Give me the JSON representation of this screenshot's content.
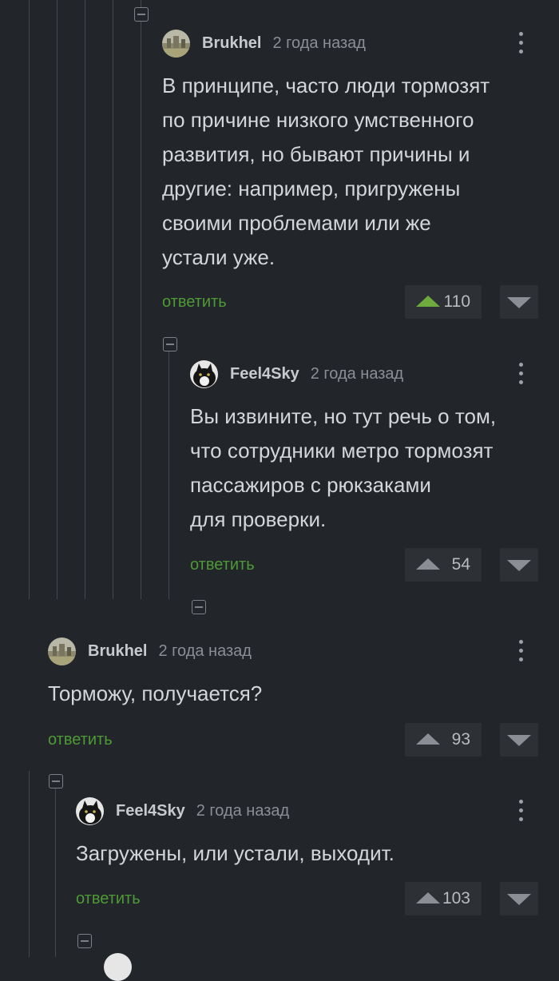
{
  "comments": [
    {
      "author": "Brukhel",
      "time": "2 года назад",
      "text": "В принципе, часто люди тормозят\nпо причине низкого умственного\nразвития, но бывают причины и\nдругие: например, пригружены\nсвоими проблемами или же\nустали уже.",
      "reply_label": "ответить",
      "votes": "110",
      "upvoted": true,
      "avatar": "landscape-avatar"
    },
    {
      "author": "Feel4Sky",
      "time": "2 года назад",
      "text": "Вы извините, но тут речь о том,\nчто сотрудники метро тормозят\nпассажиров с рюкзаками\nдля проверки.",
      "reply_label": "ответить",
      "votes": "54",
      "upvoted": false,
      "avatar": "cat-avatar"
    },
    {
      "author": "Brukhel",
      "time": "2 года назад",
      "text": "Торможу, получается?",
      "reply_label": "ответить",
      "votes": "93",
      "upvoted": false,
      "avatar": "landscape-avatar"
    },
    {
      "author": "Feel4Sky",
      "time": "2 года назад",
      "text": "Загружены, или устали, выходит.",
      "reply_label": "ответить",
      "votes": "103",
      "upvoted": false,
      "avatar": "cat-avatar"
    }
  ],
  "colors": {
    "background": "#222529",
    "reply_link": "#4e9a36",
    "upvote_active": "#6eaa3e"
  }
}
